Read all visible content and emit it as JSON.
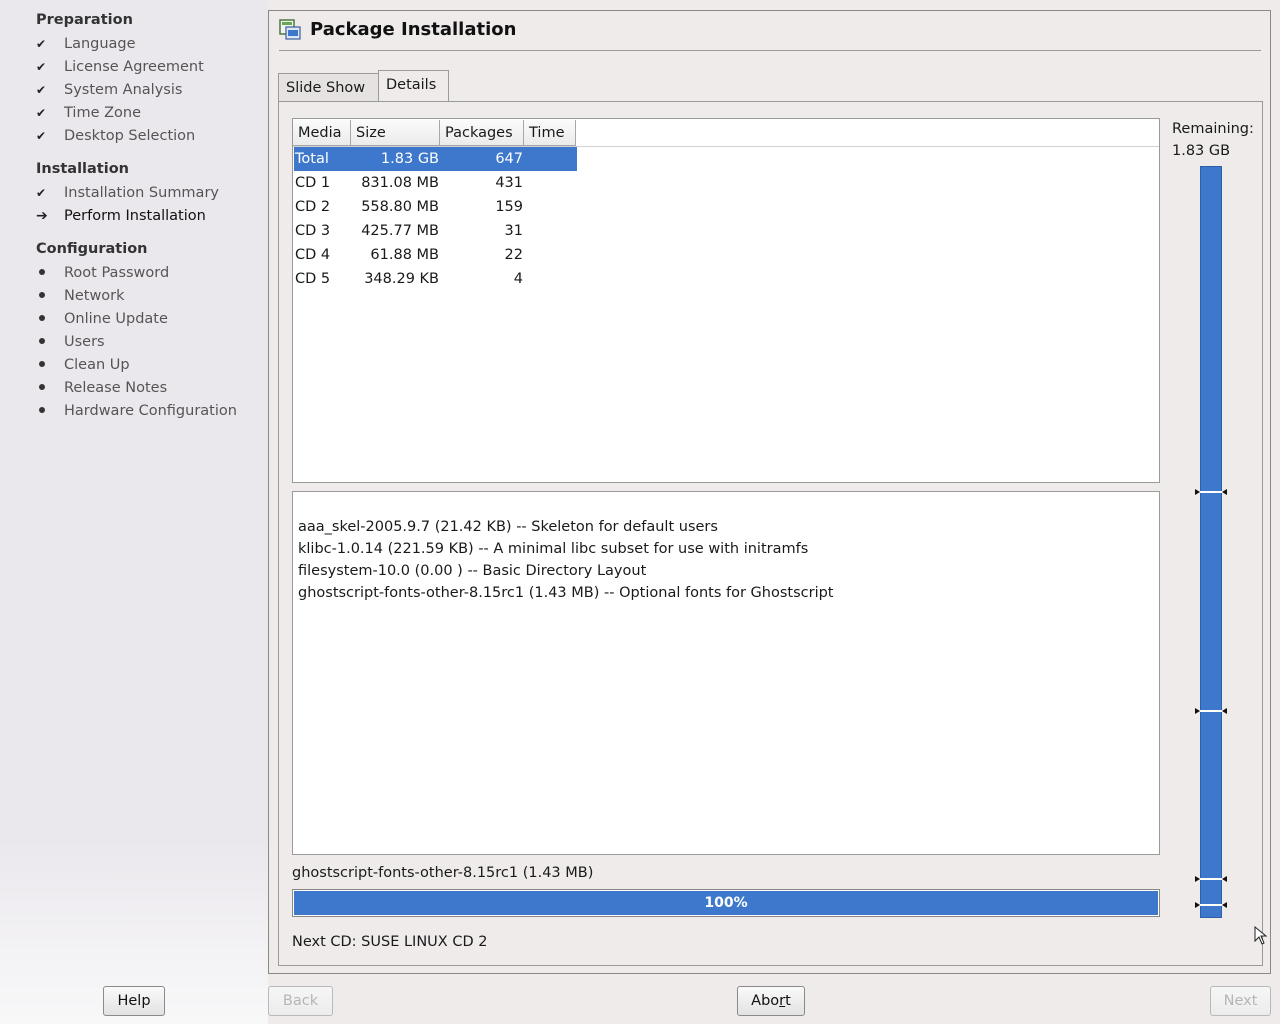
{
  "sidebar": {
    "sections": [
      {
        "title": "Preparation",
        "steps": [
          {
            "label": "Language",
            "state": "done"
          },
          {
            "label": "License Agreement",
            "state": "done"
          },
          {
            "label": "System Analysis",
            "state": "done"
          },
          {
            "label": "Time Zone",
            "state": "done"
          },
          {
            "label": "Desktop Selection",
            "state": "done"
          }
        ]
      },
      {
        "title": "Installation",
        "steps": [
          {
            "label": "Installation Summary",
            "state": "done"
          },
          {
            "label": "Perform Installation",
            "state": "current"
          }
        ]
      },
      {
        "title": "Configuration",
        "steps": [
          {
            "label": "Root Password",
            "state": "pending"
          },
          {
            "label": "Network",
            "state": "pending"
          },
          {
            "label": "Online Update",
            "state": "pending"
          },
          {
            "label": "Users",
            "state": "pending"
          },
          {
            "label": "Clean Up",
            "state": "pending"
          },
          {
            "label": "Release Notes",
            "state": "pending"
          },
          {
            "label": "Hardware Configuration",
            "state": "pending"
          }
        ]
      }
    ],
    "done_mark": "✔",
    "current_mark": "➔"
  },
  "panel": {
    "title": "Package Installation",
    "icon": "package-install-icon",
    "tabs": [
      {
        "label": "Slide Show",
        "active": false
      },
      {
        "label": "Details",
        "active": true
      }
    ]
  },
  "media_table": {
    "columns": [
      "Media",
      "Size",
      "Packages",
      "Time"
    ],
    "rows": [
      {
        "media": "Total",
        "size": "1.83 GB",
        "packages": "647",
        "time": "",
        "selected": true
      },
      {
        "media": "CD 1",
        "size": "831.08 MB",
        "packages": "431",
        "time": ""
      },
      {
        "media": "CD 2",
        "size": "558.80 MB",
        "packages": "159",
        "time": ""
      },
      {
        "media": "CD 3",
        "size": "425.77 MB",
        "packages": "31",
        "time": ""
      },
      {
        "media": "CD 4",
        "size": "61.88 MB",
        "packages": "22",
        "time": ""
      },
      {
        "media": "CD 5",
        "size": "348.29 KB",
        "packages": "4",
        "time": ""
      }
    ]
  },
  "log": {
    "lines": [
      "aaa_skel-2005.9.7 (21.42 KB) -- Skeleton for default users",
      "klibc-1.0.14 (221.59 KB) -- A minimal libc subset for use with initramfs",
      "filesystem-10.0 (0.00 ) -- Basic Directory Layout",
      "ghostscript-fonts-other-8.15rc1 (1.43 MB) -- Optional fonts for Ghostscript"
    ]
  },
  "current_package": {
    "label": "ghostscript-fonts-other-8.15rc1 (1.43 MB)",
    "progress_percent": 100,
    "progress_text": "100%"
  },
  "next_cd": "Next CD: SUSE LINUX CD 2",
  "remaining": {
    "label": "Remaining:",
    "value": "1.83 GB",
    "fill_fraction": 1.0
  },
  "buttons": {
    "help": "Help",
    "back": "Back",
    "abort_prefix": "Abo",
    "abort_underlined": "r",
    "abort_suffix": "t",
    "next": "Next"
  },
  "colors": {
    "accent": "#3e78cc",
    "selection": "#3e78cc"
  }
}
